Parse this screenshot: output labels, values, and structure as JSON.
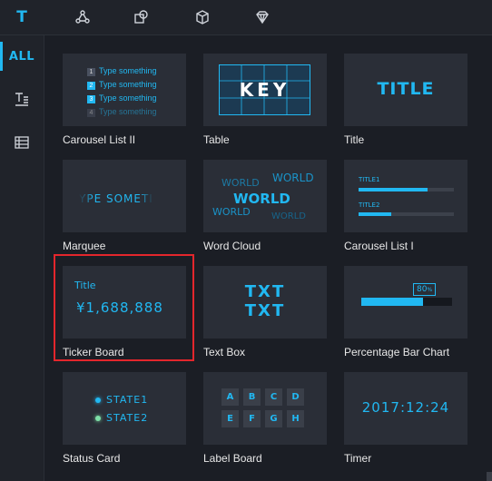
{
  "toolbar": {
    "tabs": [
      {
        "label": "T",
        "icon": "text-icon",
        "active": true
      },
      {
        "label": "",
        "icon": "relation-icon"
      },
      {
        "label": "",
        "icon": "shapes-icon"
      },
      {
        "label": "",
        "icon": "cube-icon"
      },
      {
        "label": "",
        "icon": "diamond-icon"
      }
    ]
  },
  "sidebar": {
    "items": [
      {
        "label": "ALL",
        "active": true
      },
      {
        "label": "",
        "icon": "text-list-icon"
      },
      {
        "label": "",
        "icon": "table-icon"
      }
    ]
  },
  "cards": [
    {
      "label": "Carousel List II",
      "thumb": {
        "rows": [
          "Type something",
          "Type something",
          "Type something",
          "Type something"
        ],
        "nums": [
          "1",
          "2",
          "3",
          "4"
        ]
      }
    },
    {
      "label": "Table",
      "thumb": {
        "text": "KEY"
      }
    },
    {
      "label": "Title",
      "thumb": {
        "text": "TITLE"
      }
    },
    {
      "label": "Marquee",
      "thumb": {
        "text": "YPE SOMETI"
      }
    },
    {
      "label": "Word Cloud",
      "thumb": {
        "words": [
          "WORLD",
          "WORLD",
          "WORLD",
          "WORLD",
          "WORLD"
        ]
      }
    },
    {
      "label": "Carousel List I",
      "thumb": {
        "titles": [
          "TITLE1",
          "TITLE2"
        ]
      }
    },
    {
      "label": "Ticker Board",
      "thumb": {
        "title": "Title",
        "value": "¥1,688,888"
      }
    },
    {
      "label": "Text Box",
      "thumb": {
        "line1": "TXT",
        "line2": "TXT"
      }
    },
    {
      "label": "Percentage Bar Chart",
      "thumb": {
        "value": "80",
        "unit": "%"
      }
    },
    {
      "label": "Status Card",
      "thumb": {
        "states": [
          "STATE1",
          "STATE2"
        ]
      }
    },
    {
      "label": "Label Board",
      "thumb": {
        "letters": [
          "A",
          "B",
          "C",
          "D",
          "E",
          "F",
          "G",
          "H"
        ]
      }
    },
    {
      "label": "Timer",
      "thumb": {
        "text": "2017:12:24"
      }
    }
  ],
  "colors": {
    "accent": "#21b8f2",
    "highlight": "#e3262c",
    "card_bg": "#2a2e37"
  }
}
